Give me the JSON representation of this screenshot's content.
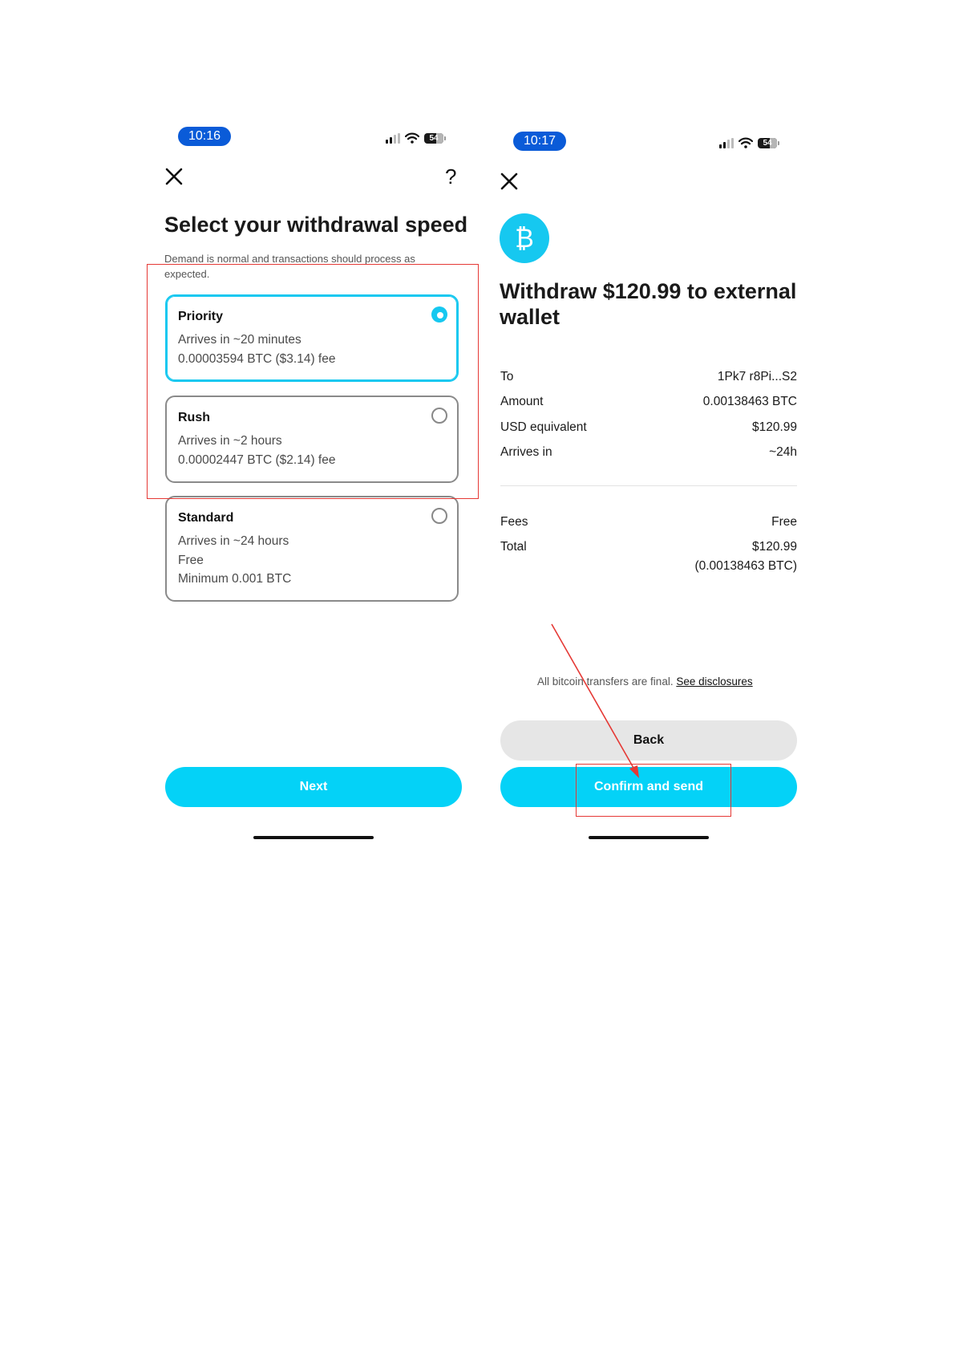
{
  "left_screen": {
    "status": {
      "time": "10:16",
      "battery": "54"
    },
    "close_icon": "close-icon",
    "help_icon": "help-icon",
    "title": "Select your withdrawal speed",
    "subtitle": "Demand is normal and transactions should process as expected.",
    "options": [
      {
        "name": "Priority",
        "line1": "Arrives in ~20 minutes",
        "line2": "0.00003594 BTC ($3.14) fee",
        "selected": true
      },
      {
        "name": "Rush",
        "line1": "Arrives in ~2 hours",
        "line2": "0.00002447 BTC ($2.14) fee",
        "selected": false
      },
      {
        "name": "Standard",
        "line1": "Arrives in ~24 hours",
        "line2": "Free",
        "line3": "Minimum 0.001 BTC",
        "selected": false
      }
    ],
    "next_label": "Next"
  },
  "right_screen": {
    "status": {
      "time": "10:17",
      "battery": "54"
    },
    "close_icon": "close-icon",
    "coin_symbol": "₿",
    "title": "Withdraw $120.99 to external wallet",
    "details": [
      {
        "label": "To",
        "value": "1Pk7 r8Pi...S2"
      },
      {
        "label": "Amount",
        "value": "0.00138463 BTC"
      },
      {
        "label": "USD equivalent",
        "value": "$120.99"
      },
      {
        "label": "Arrives in",
        "value": "~24h"
      }
    ],
    "fees_label": "Fees",
    "fees_value": "Free",
    "total_label": "Total",
    "total_value": "$120.99",
    "total_btc": "(0.00138463 BTC)",
    "disclaimer_text": "All bitcoin transfers are final.",
    "disclosures_link": "See disclosures",
    "back_label": "Back",
    "confirm_label": "Confirm and send"
  },
  "annotation_color": "#e53935"
}
